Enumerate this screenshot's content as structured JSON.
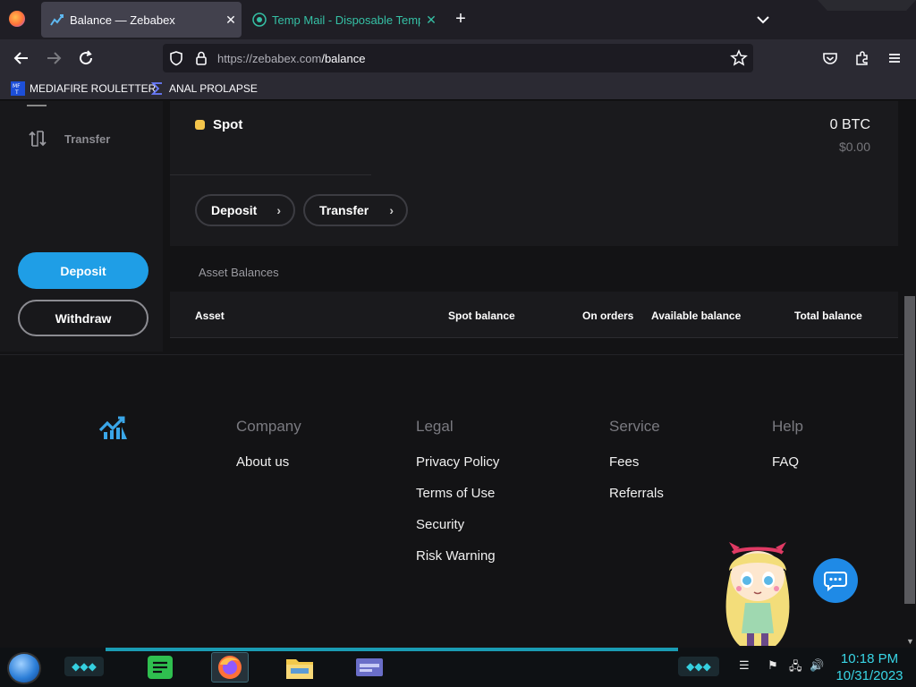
{
  "browser": {
    "tabs": [
      {
        "title": "Balance — Zebabex",
        "active": true
      },
      {
        "title": "Temp Mail - Disposable Tempo",
        "active": false
      }
    ],
    "url_domain": "https://zebabex.com",
    "url_path": "/balance",
    "bookmarks": [
      {
        "label": "MEDIAFIRE ROULETTER"
      },
      {
        "label": "ANAL PROLAPSE"
      }
    ]
  },
  "sidebar": {
    "transfer_label": "Transfer",
    "deposit_label": "Deposit",
    "withdraw_label": "Withdraw"
  },
  "wallet": {
    "name": "Spot",
    "balance": "0 BTC",
    "balance_usd": "$0.00",
    "actions": {
      "deposit": "Deposit",
      "transfer": "Transfer"
    }
  },
  "assets": {
    "section_title": "Asset Balances",
    "columns": [
      "Asset",
      "Spot balance",
      "On orders",
      "Available balance",
      "Total balance"
    ]
  },
  "footer": {
    "columns": [
      {
        "heading": "Company",
        "links": [
          "About us"
        ]
      },
      {
        "heading": "Legal",
        "links": [
          "Privacy Policy",
          "Terms of Use",
          "Security",
          "Risk Warning"
        ]
      },
      {
        "heading": "Service",
        "links": [
          "Fees",
          "Referrals"
        ]
      },
      {
        "heading": "Help",
        "links": [
          "FAQ"
        ]
      }
    ]
  },
  "taskbar": {
    "time": "10:18 PM",
    "date": "10/31/2023"
  },
  "colors": {
    "accent": "#1f9ee6",
    "spot_dot": "#f4c54b",
    "page_bg": "#131315",
    "clock": "#39d6e6"
  }
}
